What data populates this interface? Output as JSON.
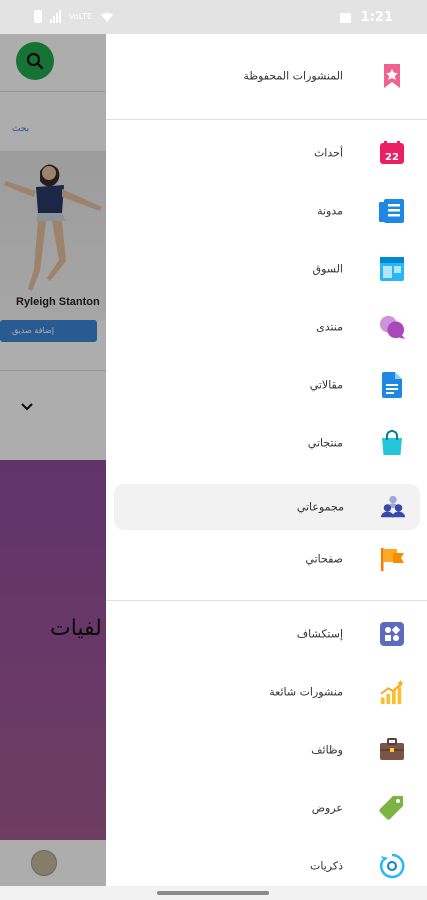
{
  "status_bar": {
    "carrier_text": "VoLTE",
    "time": "1:21"
  },
  "background": {
    "more_link": "بحث",
    "profile_name": "Ryleigh Stanton",
    "add_friend_label": "إضافة صديق",
    "banner_text": "لفيات",
    "overlay_color": "#000000"
  },
  "drawer": {
    "items": [
      {
        "label": "المنشورات المحفوظة",
        "icon": "bookmark-icon"
      },
      {
        "label": "أحداث",
        "icon": "calendar-icon"
      },
      {
        "label": "مدونة",
        "icon": "blog-icon"
      },
      {
        "label": "السوق",
        "icon": "market-icon"
      },
      {
        "label": "منتدى",
        "icon": "forum-icon"
      },
      {
        "label": "مقالاتي",
        "icon": "articles-icon"
      },
      {
        "label": "منتجاتي",
        "icon": "products-icon"
      },
      {
        "label": "مجموعاتي",
        "icon": "groups-icon"
      },
      {
        "label": "صفحاتي",
        "icon": "pages-icon"
      },
      {
        "label": "إستكشاف",
        "icon": "explore-icon"
      },
      {
        "label": "منشورات شائعة",
        "icon": "popular-icon"
      },
      {
        "label": "وظائف",
        "icon": "jobs-icon"
      },
      {
        "label": "عروض",
        "icon": "offers-icon"
      },
      {
        "label": "ذكريات",
        "icon": "memories-icon"
      }
    ],
    "active_index": 7
  },
  "colors": {
    "accent_green": "#1faa4f",
    "purple_banner": "#9c5598",
    "active_row_bg": "#f2f2f2"
  }
}
